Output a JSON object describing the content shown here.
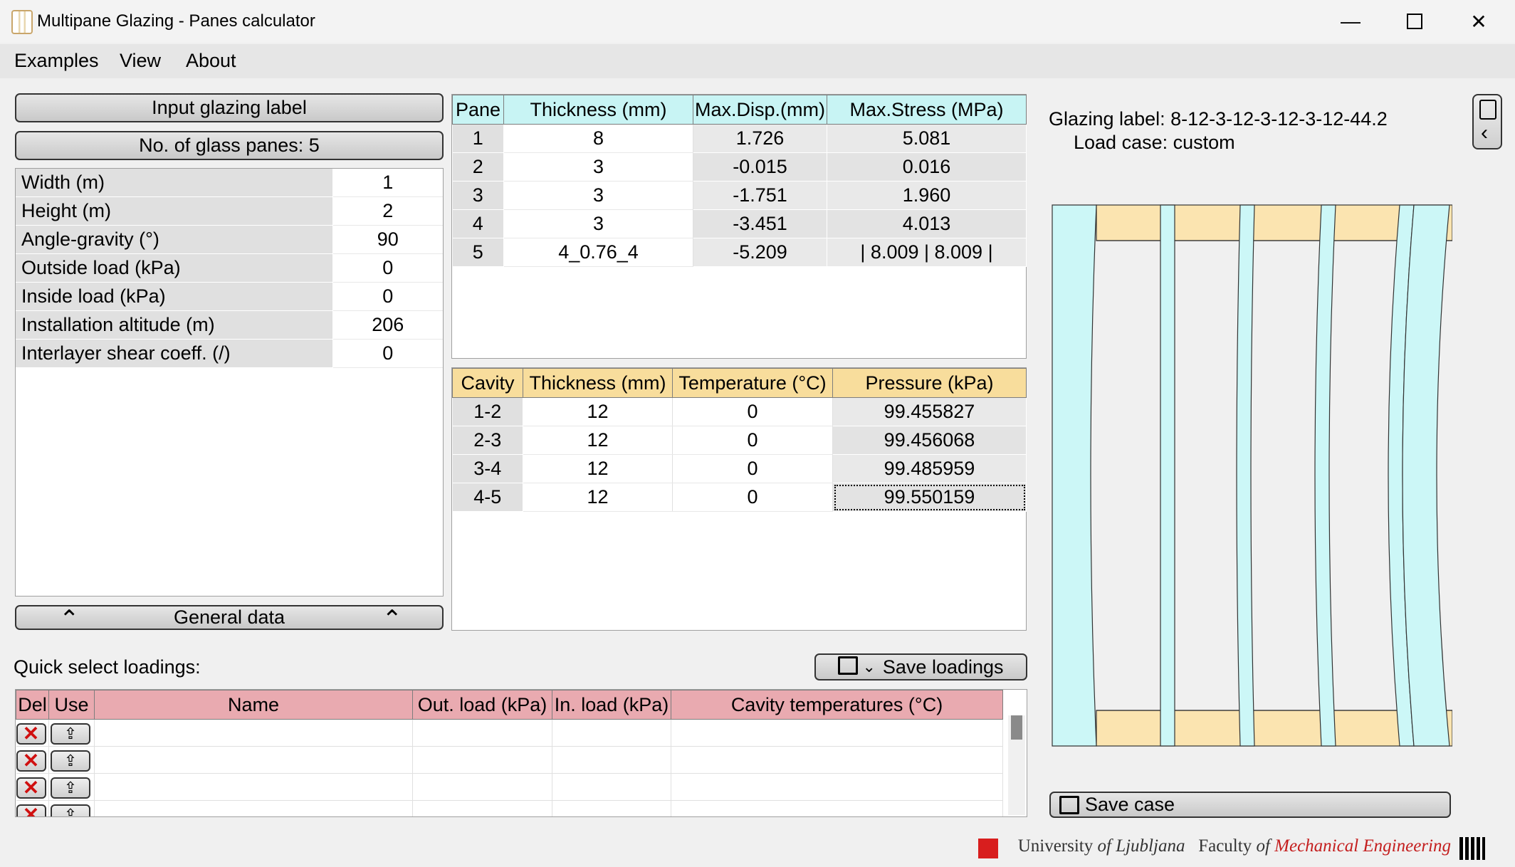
{
  "window": {
    "title": "Multipane Glazing - Panes calculator"
  },
  "menu": [
    "Examples",
    "View",
    "About"
  ],
  "left": {
    "input_label_button": "Input glazing label",
    "panes_button": "No. of glass panes: 5",
    "general_data": [
      {
        "label": "Width (m)",
        "value": "1"
      },
      {
        "label": "Height (m)",
        "value": "2"
      },
      {
        "label": "Angle-gravity (°)",
        "value": "90"
      },
      {
        "label": "Outside load (kPa)",
        "value": "0"
      },
      {
        "label": "Inside load (kPa)",
        "value": "0"
      },
      {
        "label": "Installation altitude (m)",
        "value": "206"
      },
      {
        "label": "Interlayer shear coeff. (/)",
        "value": "0"
      }
    ],
    "general_data_button": "General data"
  },
  "panes": {
    "headers": [
      "Pane",
      "Thickness (mm)",
      "Max.Disp.(mm)",
      "Max.Stress (MPa)"
    ],
    "rows": [
      [
        "1",
        "8",
        "1.726",
        "5.081"
      ],
      [
        "2",
        "3",
        "-0.015",
        "0.016"
      ],
      [
        "3",
        "3",
        "-1.751",
        "1.960"
      ],
      [
        "4",
        "3",
        "-3.451",
        "4.013"
      ],
      [
        "5",
        "4_0.76_4",
        "-5.209",
        "| 8.009 | 8.009 |"
      ]
    ]
  },
  "cavities": {
    "headers": [
      "Cavity",
      "Thickness (mm)",
      "Temperature (°C)",
      "Pressure (kPa)"
    ],
    "rows": [
      [
        "1-2",
        "12",
        "0",
        "99.455827"
      ],
      [
        "2-3",
        "12",
        "0",
        "99.456068"
      ],
      [
        "3-4",
        "12",
        "0",
        "99.485959"
      ],
      [
        "4-5",
        "12",
        "0",
        "99.550159"
      ]
    ]
  },
  "loadings": {
    "title": "Quick select loadings:",
    "save_button": "Save loadings",
    "headers": [
      "Del",
      "Use",
      "Name",
      "Out. load (kPa)",
      "In. load (kPa)",
      "Cavity temperatures (°C)"
    ],
    "row_count": 4
  },
  "right": {
    "glazing_label_caption": "Glazing label:",
    "glazing_label_value": "8-12-3-12-3-12-3-12-44.2",
    "load_case_caption": "Load case:",
    "load_case_value": "custom",
    "save_case_button": "Save case"
  },
  "footer": {
    "university": "University",
    "of1": "of",
    "city": "Ljubljana",
    "faculty": "Faculty",
    "of2": "of",
    "dept": "Mechanical Engineering"
  },
  "colors": {
    "pane": "#ccf7f7",
    "spacer": "#fbe4b0",
    "pane_header": "#c8f4f4",
    "cavity_header": "#f8dd9c",
    "loadings_header": "#e9aab0",
    "logo_red": "#d81e1e"
  }
}
